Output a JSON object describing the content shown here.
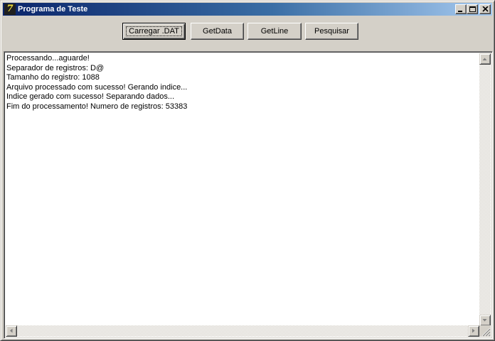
{
  "window": {
    "title": "Programa de Teste",
    "icon": "delphi-app-icon",
    "icon_glyph": "7",
    "controls": [
      "minimize-icon",
      "maximize-icon",
      "close-icon"
    ]
  },
  "toolbar": {
    "load_label": "Carregar .DAT",
    "getdata_label": "GetData",
    "getline_label": "GetLine",
    "search_label": "Pesquisar"
  },
  "log": {
    "lines": [
      "Processando...aguarde!",
      "Separador de registros: D@",
      "Tamanho do registro: 1088",
      "Arquivo processado com sucesso! Gerando indice...",
      "Indice gerado com sucesso! Separando dados...",
      "Fim do processamento! Numero de registros: 53383"
    ]
  },
  "colors": {
    "titlebar_start": "#0a246a",
    "titlebar_end": "#a6caf0",
    "face": "#d4d0c8",
    "memo_background": "#ffffff"
  }
}
